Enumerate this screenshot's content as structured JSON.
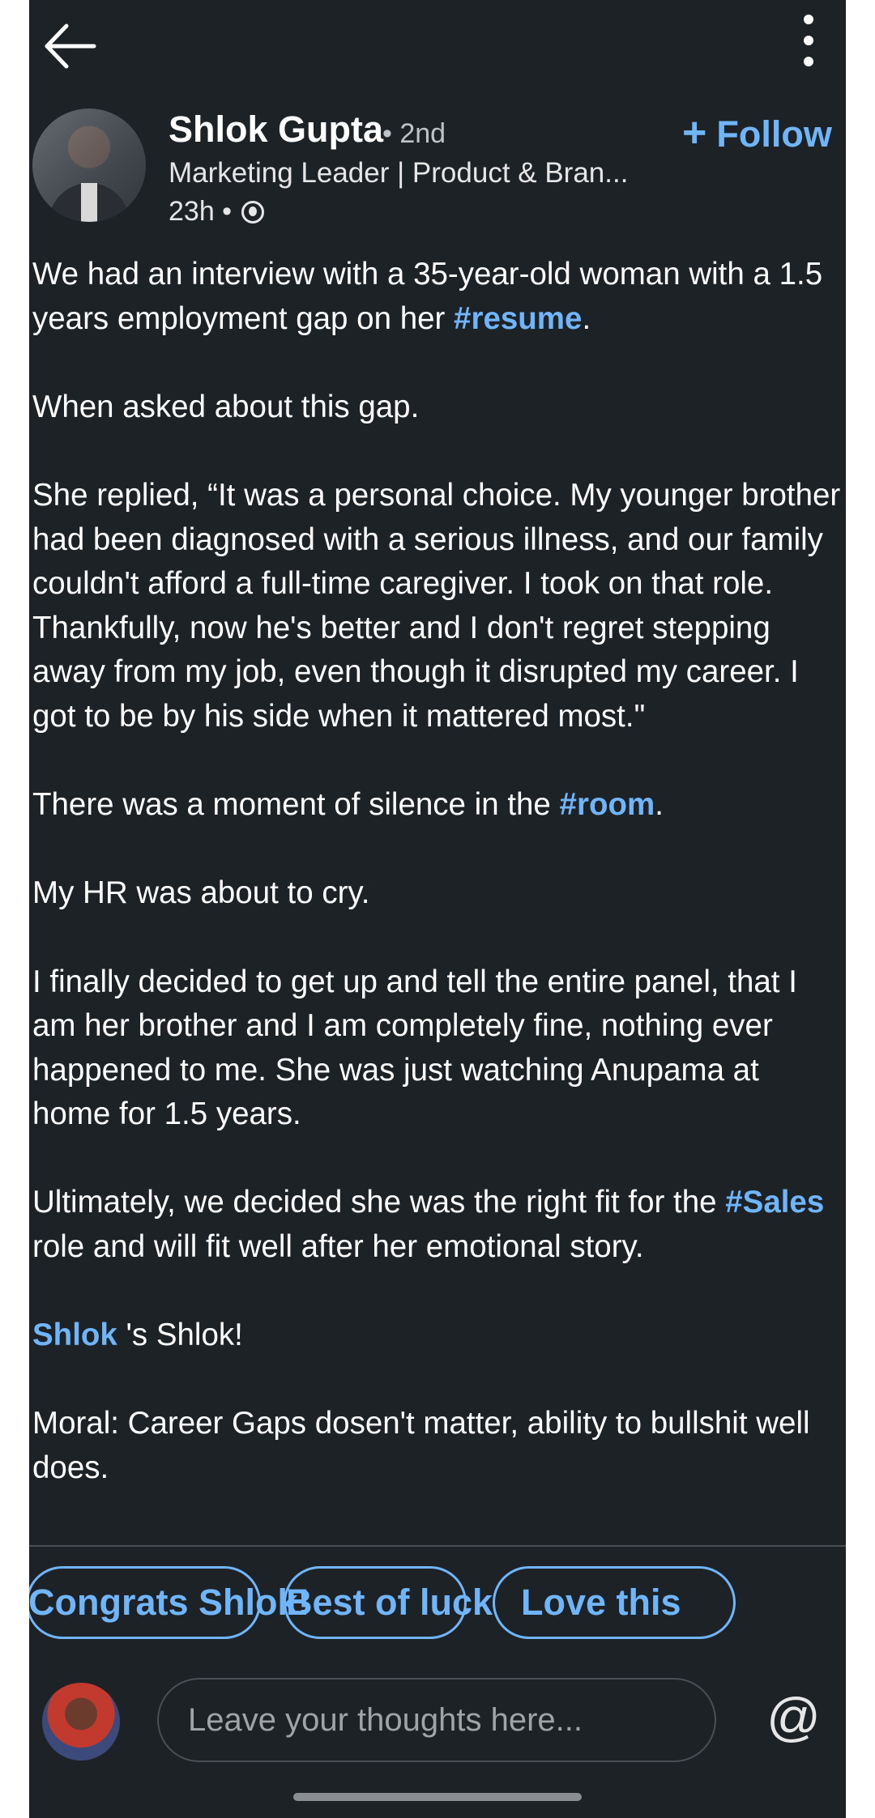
{
  "post": {
    "author": {
      "name": "Shlok Gupta",
      "degree": "• 2nd",
      "headline": "Marketing Leader | Product & Bran...",
      "time": "23h •"
    },
    "follow_label": "Follow",
    "paragraphs": [
      [
        {
          "t": "We had an interview with a 35-year-old woman with a 1.5 years employment gap on her "
        },
        {
          "t": "#resume",
          "tag": true
        },
        {
          "t": "."
        }
      ],
      [
        {
          "t": "When asked about this gap."
        }
      ],
      [
        {
          "t": "She replied, “It was a personal choice. My younger brother had been diagnosed with a serious illness, and our family couldn't afford a full-time caregiver. I took on that role. Thankfully, now he's better and I don't regret stepping away from my job, even though it disrupted my career. I got to be by his side when it mattered most.\""
        }
      ],
      [
        {
          "t": "There was a moment of silence in the "
        },
        {
          "t": "#room",
          "tag": true
        },
        {
          "t": "."
        }
      ],
      [
        {
          "t": "My HR was about to cry."
        }
      ],
      [
        {
          "t": "I finally decided to get up and tell the entire panel, that I am her brother and I am completely fine, nothing ever happened to me. She was just watching Anupama at home for 1.5 years."
        }
      ],
      [
        {
          "t": "Ultimately, we decided she was the right fit for the "
        },
        {
          "t": "#Sales",
          "tag": true
        },
        {
          "t": " role and will fit well after her emotional story."
        }
      ],
      [
        {
          "t": "Shlok",
          "tag": true
        },
        {
          "t": " 's Shlok!"
        }
      ],
      [
        {
          "t": "Moral: Career Gaps dosen't matter, ability to bullshit well does."
        }
      ]
    ]
  },
  "suggestions": [
    "Congrats Shlok!",
    "Best of luck",
    "Love this"
  ],
  "comment": {
    "placeholder": "Leave your thoughts here..."
  },
  "icons": {
    "back": "arrow-left-icon",
    "more": "more-vertical-icon",
    "globe": "globe-icon",
    "mention": "at-icon"
  },
  "colors": {
    "background": "#1d2226",
    "accent": "#70b5f9"
  }
}
